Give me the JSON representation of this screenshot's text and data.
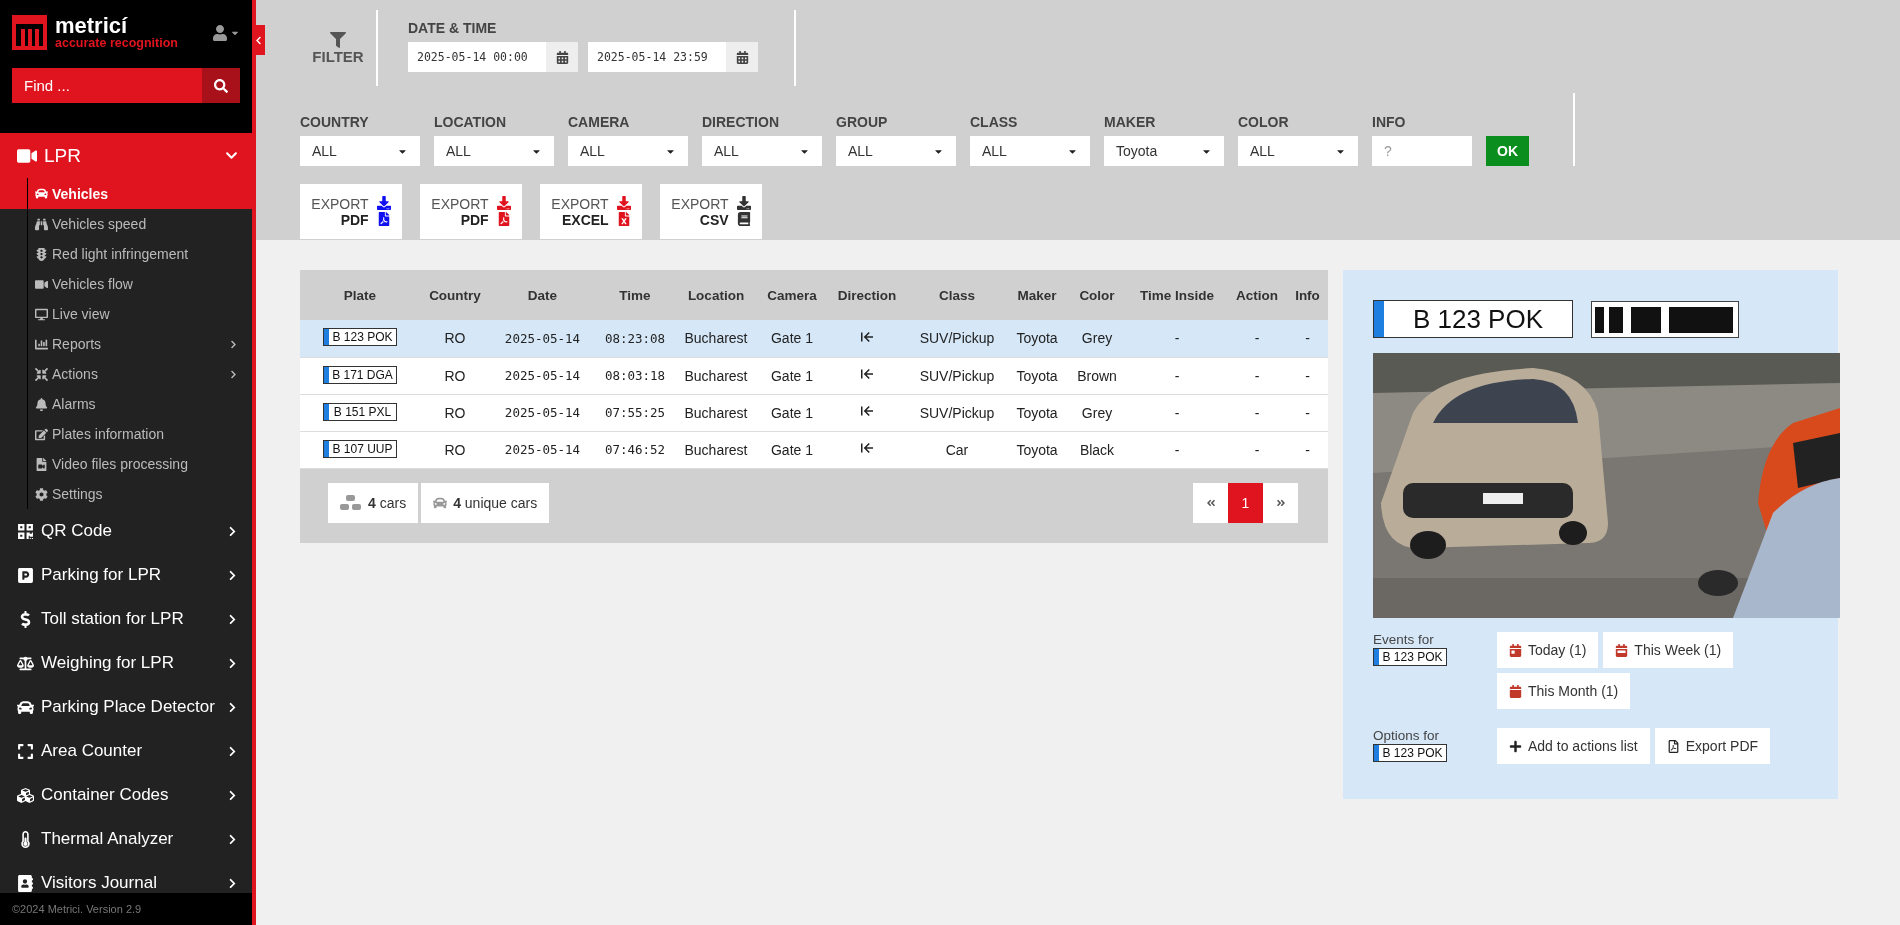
{
  "sidebar": {
    "logo": {
      "name": "metricí",
      "tagline": "accurate recognition"
    },
    "search": {
      "placeholder": "Find ..."
    },
    "menu": [
      {
        "label": "LPR",
        "expanded": true,
        "selected": true,
        "children": [
          {
            "label": "Vehicles",
            "selected": true,
            "expandable": false
          },
          {
            "label": "Vehicles speed",
            "selected": false,
            "expandable": false
          },
          {
            "label": "Red light infringement",
            "selected": false,
            "expandable": false
          },
          {
            "label": "Vehicles flow",
            "selected": false,
            "expandable": false
          },
          {
            "label": "Live view",
            "selected": false,
            "expandable": false
          },
          {
            "label": "Reports",
            "selected": false,
            "expandable": true
          },
          {
            "label": "Actions",
            "selected": false,
            "expandable": true
          },
          {
            "label": "Alarms",
            "selected": false,
            "expandable": false
          },
          {
            "label": "Plates information",
            "selected": false,
            "expandable": false
          },
          {
            "label": "Video files processing",
            "selected": false,
            "expandable": false
          },
          {
            "label": "Settings",
            "selected": false,
            "expandable": false
          }
        ]
      },
      {
        "label": "QR Code",
        "expanded": false,
        "selected": false
      },
      {
        "label": "Parking for LPR",
        "expanded": false,
        "selected": false
      },
      {
        "label": "Toll station for LPR",
        "expanded": false,
        "selected": false
      },
      {
        "label": "Weighing for LPR",
        "expanded": false,
        "selected": false
      },
      {
        "label": "Parking Place Detector",
        "expanded": false,
        "selected": false
      },
      {
        "label": "Area Counter",
        "expanded": false,
        "selected": false
      },
      {
        "label": "Container Codes",
        "expanded": false,
        "selected": false
      },
      {
        "label": "Thermal Analyzer",
        "expanded": false,
        "selected": false
      },
      {
        "label": "Visitors Journal",
        "expanded": false,
        "selected": false
      }
    ],
    "footer": "©2024 Metrici. Version 2.9"
  },
  "filter": {
    "title": "FILTER",
    "date_time": {
      "label": "DATE & TIME",
      "from": "2025-05-14 00:00",
      "to": "2025-05-14 23:59"
    },
    "selects": [
      {
        "label": "COUNTRY",
        "value": "ALL"
      },
      {
        "label": "LOCATION",
        "value": "ALL"
      },
      {
        "label": "CAMERA",
        "value": "ALL"
      },
      {
        "label": "DIRECTION",
        "value": "ALL"
      },
      {
        "label": "GROUP",
        "value": "ALL"
      },
      {
        "label": "CLASS",
        "value": "ALL"
      },
      {
        "label": "MAKER",
        "value": "Toyota"
      },
      {
        "label": "COLOR",
        "value": "ALL"
      }
    ],
    "info": {
      "label": "INFO",
      "placeholder": "?"
    },
    "ok": "OK",
    "exports": [
      {
        "top": "EXPORT",
        "format": "PDF",
        "color": "#1010f0"
      },
      {
        "top": "EXPORT",
        "format": "PDF",
        "color": "#e0141e"
      },
      {
        "top": "EXPORT",
        "format": "EXCEL",
        "color": "#e0141e"
      },
      {
        "top": "EXPORT",
        "format": "CSV",
        "color": "#333333"
      }
    ]
  },
  "table": {
    "columns": [
      "Plate",
      "Country",
      "Date",
      "Time",
      "Location",
      "Camera",
      "Direction",
      "Class",
      "Maker",
      "Color",
      "Time Inside",
      "Action",
      "Info"
    ],
    "rows": [
      {
        "selected": true,
        "plate": "B 123 POK",
        "country": "RO",
        "date": "2025-05-14",
        "time": "08:23:08",
        "location": "Bucharest",
        "camera": "Gate 1",
        "class": "SUV/Pickup",
        "maker": "Toyota",
        "vehicle_color": "Grey",
        "time_inside": "-",
        "action": "-",
        "info": "-"
      },
      {
        "selected": false,
        "plate": "B 171 DGA",
        "country": "RO",
        "date": "2025-05-14",
        "time": "08:03:18",
        "location": "Bucharest",
        "camera": "Gate 1",
        "class": "SUV/Pickup",
        "maker": "Toyota",
        "vehicle_color": "Brown",
        "time_inside": "-",
        "action": "-",
        "info": "-"
      },
      {
        "selected": false,
        "plate": "B 151 PXL",
        "country": "RO",
        "date": "2025-05-14",
        "time": "07:55:25",
        "location": "Bucharest",
        "camera": "Gate 1",
        "class": "SUV/Pickup",
        "maker": "Toyota",
        "vehicle_color": "Grey",
        "time_inside": "-",
        "action": "-",
        "info": "-"
      },
      {
        "selected": false,
        "plate": "B 107 UUP",
        "country": "RO",
        "date": "2025-05-14",
        "time": "07:46:52",
        "location": "Bucharest",
        "camera": "Gate 1",
        "class": "Car",
        "maker": "Toyota",
        "vehicle_color": "Black",
        "time_inside": "-",
        "action": "-",
        "info": "-"
      }
    ],
    "counts": [
      {
        "value": "4",
        "label": "cars"
      },
      {
        "value": "4",
        "label": "unique cars"
      }
    ],
    "pages": [
      {
        "label": "1",
        "selected": true
      }
    ]
  },
  "detail": {
    "plate": "B 123 POK",
    "events": {
      "label": "Events for",
      "plate": "B 123 POK",
      "buttons": [
        "Today (1)",
        "This Week (1)",
        "This Month (1)"
      ]
    },
    "options": {
      "label": "Options for",
      "plate": "B 123 POK",
      "buttons": [
        "Add to actions list",
        "Export PDF"
      ]
    }
  }
}
